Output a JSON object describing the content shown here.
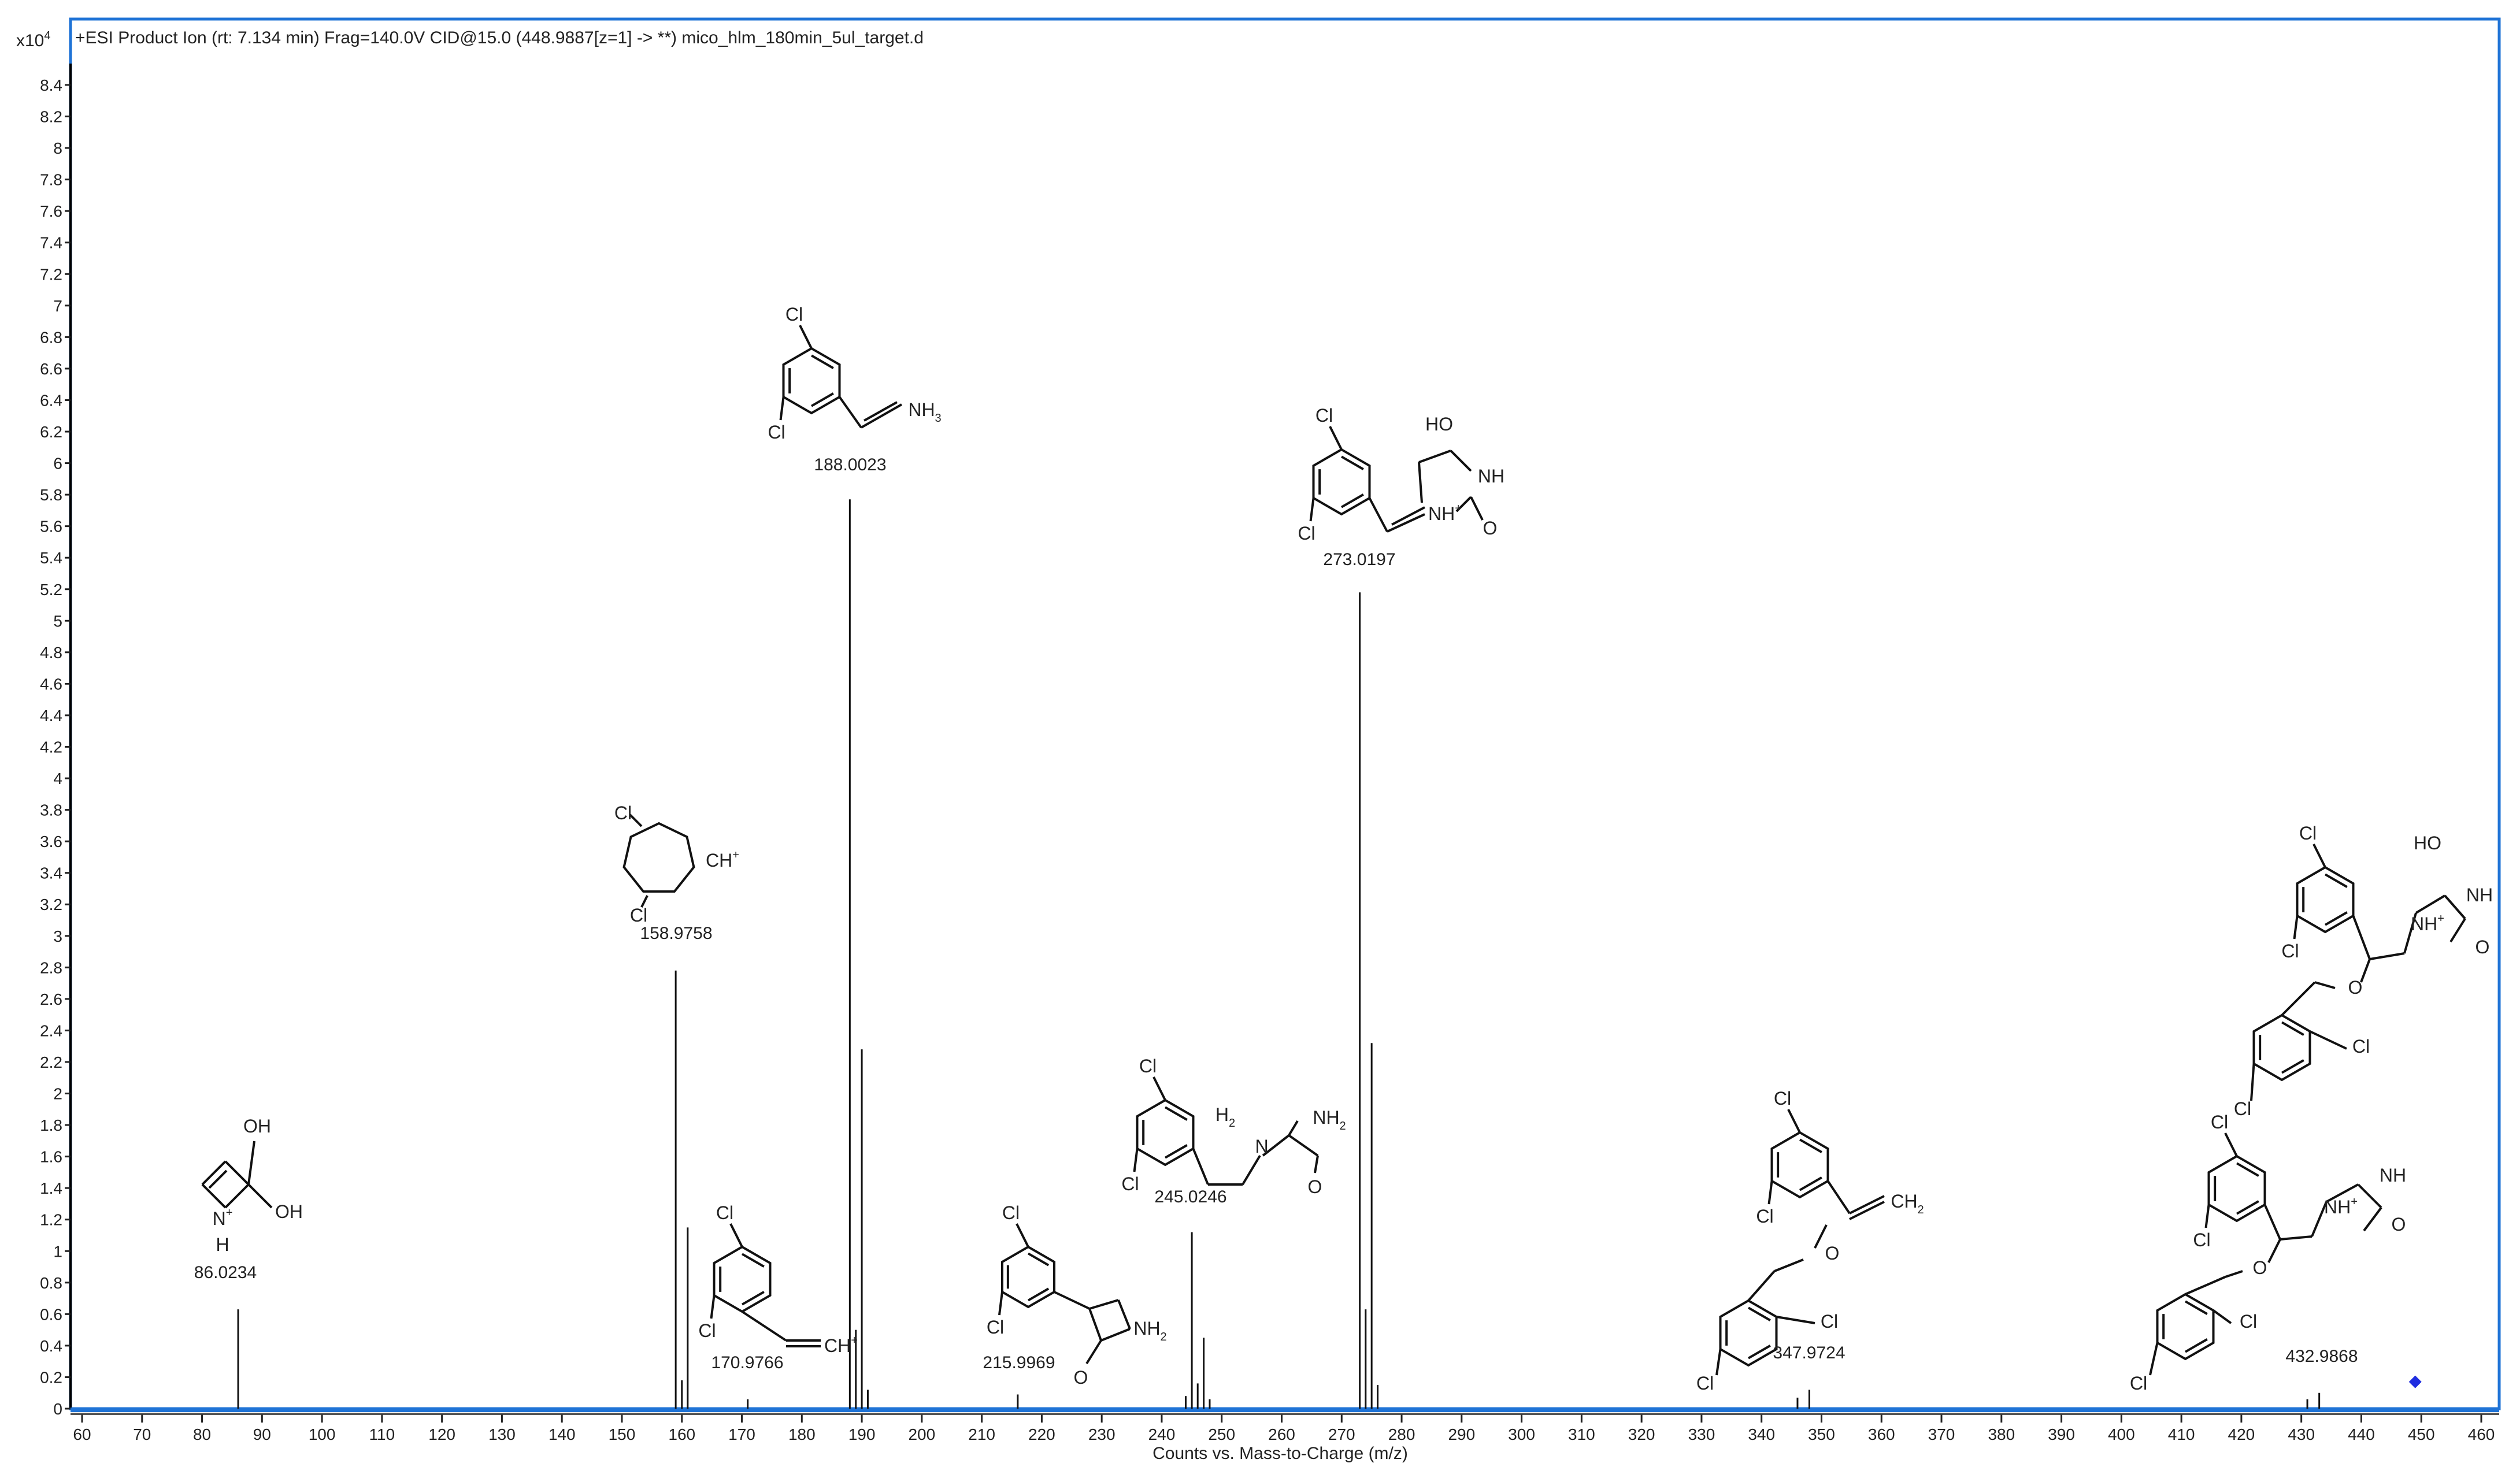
{
  "chart_data": {
    "type": "bar",
    "title": "+ESI Product Ion (rt: 7.134 min) Frag=140.0V CID@15.0 (448.9887[z=1] -> **) mico_hlm_180min_5ul_target.d",
    "y_scale_label": "x10",
    "y_scale_exp": "4",
    "xlabel": "Counts vs. Mass-to-Charge (m/z)",
    "ylabel": "",
    "xlim": [
      58,
      462
    ],
    "ylim": [
      0,
      8.8
    ],
    "x_ticks": [
      60,
      70,
      80,
      90,
      100,
      110,
      120,
      130,
      140,
      150,
      160,
      170,
      180,
      190,
      200,
      210,
      220,
      230,
      240,
      250,
      260,
      270,
      280,
      290,
      300,
      310,
      320,
      330,
      340,
      350,
      360,
      370,
      380,
      390,
      400,
      410,
      420,
      430,
      440,
      450,
      460
    ],
    "y_ticks": [
      "0",
      "0.2",
      "0.4",
      "0.6",
      "0.8",
      "1",
      "1.2",
      "1.4",
      "1.6",
      "1.8",
      "2",
      "2.2",
      "2.4",
      "2.6",
      "2.8",
      "3",
      "3.2",
      "3.4",
      "3.6",
      "3.8",
      "4",
      "4.2",
      "4.4",
      "4.6",
      "4.8",
      "5",
      "5.2",
      "5.4",
      "5.6",
      "5.8",
      "6",
      "6.2",
      "6.4",
      "6.6",
      "6.8",
      "7",
      "7.2",
      "7.4",
      "7.6",
      "7.8",
      "8",
      "8.2",
      "8.4"
    ],
    "peaks": [
      {
        "mz": 86.0234,
        "intensity": 0.63
      },
      {
        "mz": 158.9758,
        "intensity": 2.78
      },
      {
        "mz": 160.0,
        "intensity": 0.18
      },
      {
        "mz": 160.97,
        "intensity": 1.15
      },
      {
        "mz": 170.9766,
        "intensity": 0.06
      },
      {
        "mz": 188.0023,
        "intensity": 5.77
      },
      {
        "mz": 189.0,
        "intensity": 0.5
      },
      {
        "mz": 190.0,
        "intensity": 2.28
      },
      {
        "mz": 191.0,
        "intensity": 0.12
      },
      {
        "mz": 215.9969,
        "intensity": 0.09
      },
      {
        "mz": 244.0,
        "intensity": 0.08
      },
      {
        "mz": 245.0246,
        "intensity": 1.12
      },
      {
        "mz": 246.0,
        "intensity": 0.16
      },
      {
        "mz": 247.0,
        "intensity": 0.45
      },
      {
        "mz": 248.0,
        "intensity": 0.06
      },
      {
        "mz": 273.0197,
        "intensity": 5.18
      },
      {
        "mz": 274.0,
        "intensity": 0.63
      },
      {
        "mz": 275.0,
        "intensity": 2.32
      },
      {
        "mz": 276.0,
        "intensity": 0.15
      },
      {
        "mz": 346.0,
        "intensity": 0.07
      },
      {
        "mz": 347.9724,
        "intensity": 0.12
      },
      {
        "mz": 431.0,
        "intensity": 0.06
      },
      {
        "mz": 432.9868,
        "intensity": 0.1
      }
    ],
    "precursor": {
      "mz": 448.9887,
      "intensity": 0.17,
      "color": "#1f2de0"
    },
    "annotations": [
      "86.0234",
      "158.9758",
      "170.9766",
      "188.0023",
      "215.9969",
      "245.0246",
      "273.0197",
      "347.9724",
      "432.9868"
    ],
    "frame_color": "#1f73d6",
    "grid": false
  },
  "chem": {
    "cl": "Cl",
    "oh": "OH",
    "ho": "HO",
    "nh": "NH",
    "nhp": "NH",
    "h": "H",
    "o": "O",
    "nh2": "NH",
    "nh3": "NH",
    "ch": "CH",
    "ch2": "CH",
    "h2c": "H",
    "c": "C",
    "plus": "+",
    "dot": "•",
    "two": "2",
    "three": "3",
    "n": "N",
    "nh2u": "NH"
  }
}
